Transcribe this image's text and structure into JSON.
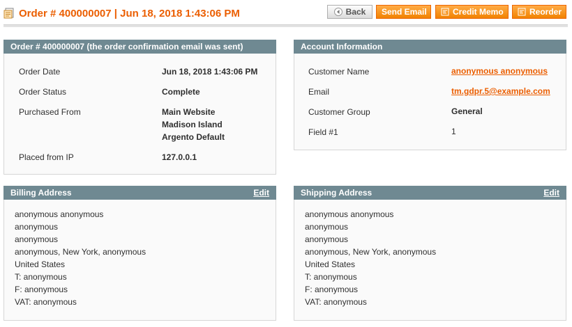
{
  "header": {
    "title": "Order # 400000007 | Jun 18, 2018 1:43:06 PM",
    "icon": "order-icon",
    "buttons": {
      "back": "Back",
      "send_email": "Send Email",
      "credit_memo": "Credit Memo",
      "reorder": "Reorder"
    }
  },
  "order_box": {
    "title": "Order # 400000007 (the order confirmation email was sent)",
    "rows": [
      {
        "label": "Order Date",
        "value": [
          "Jun 18, 2018 1:43:06 PM"
        ]
      },
      {
        "label": "Order Status",
        "value": [
          "Complete"
        ]
      },
      {
        "label": "Purchased From",
        "value": [
          "Main Website",
          "Madison Island",
          "Argento Default"
        ]
      },
      {
        "label": "Placed from IP",
        "value": [
          "127.0.0.1"
        ]
      }
    ]
  },
  "account_box": {
    "title": "Account Information",
    "rows": [
      {
        "label": "Customer Name",
        "value": "anonymous anonymous"
      },
      {
        "label": "Email",
        "value": "tm.gdpr.5@example.com"
      },
      {
        "label": "Customer Group",
        "value": "General"
      },
      {
        "label": "Field #1",
        "value": "1"
      }
    ]
  },
  "billing_box": {
    "title": "Billing Address",
    "edit": "Edit",
    "lines": [
      "anonymous anonymous",
      "anonymous",
      "anonymous",
      "anonymous, New York, anonymous",
      "United States",
      "T: anonymous",
      "F: anonymous",
      "VAT: anonymous"
    ]
  },
  "shipping_box": {
    "title": "Shipping Address",
    "edit": "Edit",
    "lines": [
      "anonymous anonymous",
      "anonymous",
      "anonymous",
      "anonymous, New York, anonymous",
      "United States",
      "T: anonymous",
      "F: anonymous",
      "VAT: anonymous"
    ]
  },
  "colors": {
    "accent": "#eb5e00",
    "box_header": "#6f8992",
    "button": "#f18200"
  }
}
